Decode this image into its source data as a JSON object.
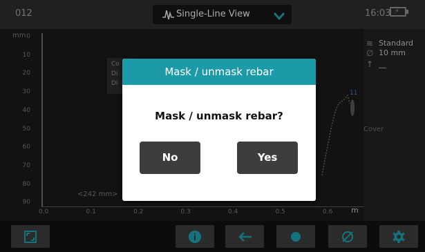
{
  "topbar": {
    "device_id": "012",
    "view_selector": {
      "label": "Single-Line View",
      "icon": "waveform-icon"
    },
    "time": "16:03",
    "battery_icon": "battery-charging-icon"
  },
  "plot": {
    "y_unit": "mm",
    "y_ticks": [
      "0",
      "10",
      "20",
      "30",
      "40",
      "50",
      "60",
      "70",
      "80",
      "90"
    ],
    "x_ticks": [
      "0.0",
      "0.1",
      "0.2",
      "0.3",
      "0.4",
      "0.5",
      "0.6"
    ],
    "x_unit": "m",
    "info_lines": [
      "Co",
      "Di",
      "Di"
    ],
    "distance_label": "<242 mm>",
    "rebar_number": "11"
  },
  "side_panel": {
    "legend": [
      {
        "icon": "≋",
        "text": "Standard"
      },
      {
        "icon": "∅",
        "text": "10 mm"
      },
      {
        "icon": "↑",
        "text": "__"
      }
    ],
    "cover_label": "Cover"
  },
  "toolbar": {
    "buttons": [
      "fullscreen-icon",
      "info-icon",
      "back-arrow-icon",
      "record-icon",
      "diameter-icon",
      "settings-icon"
    ]
  },
  "dialog": {
    "title": "Mask / unmask rebar",
    "message": "Mask / unmask rebar?",
    "no_label": "No",
    "yes_label": "Yes",
    "accent_color": "#1d9aa8"
  }
}
